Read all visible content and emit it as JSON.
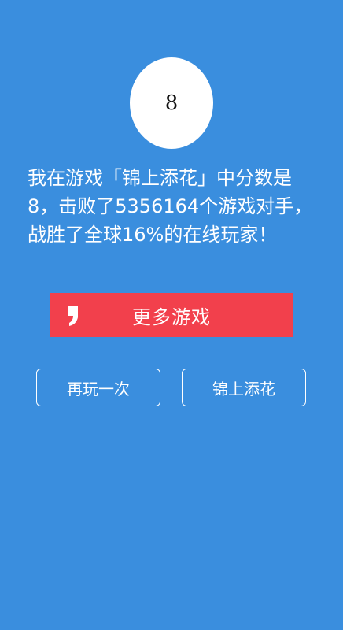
{
  "score": {
    "value": "8"
  },
  "result": {
    "message": "我在游戏「锦上添花」中分数是8，击败了5356164个游戏对手，战胜了全球16%的在线玩家！"
  },
  "more_games": {
    "label": "更多游戏",
    "icon": "comma-logo-icon",
    "color": "#f2404c"
  },
  "actions": {
    "replay_label": "再玩一次",
    "game_label": "锦上添花"
  },
  "theme": {
    "background": "#3a8ede",
    "text": "#ffffff"
  }
}
